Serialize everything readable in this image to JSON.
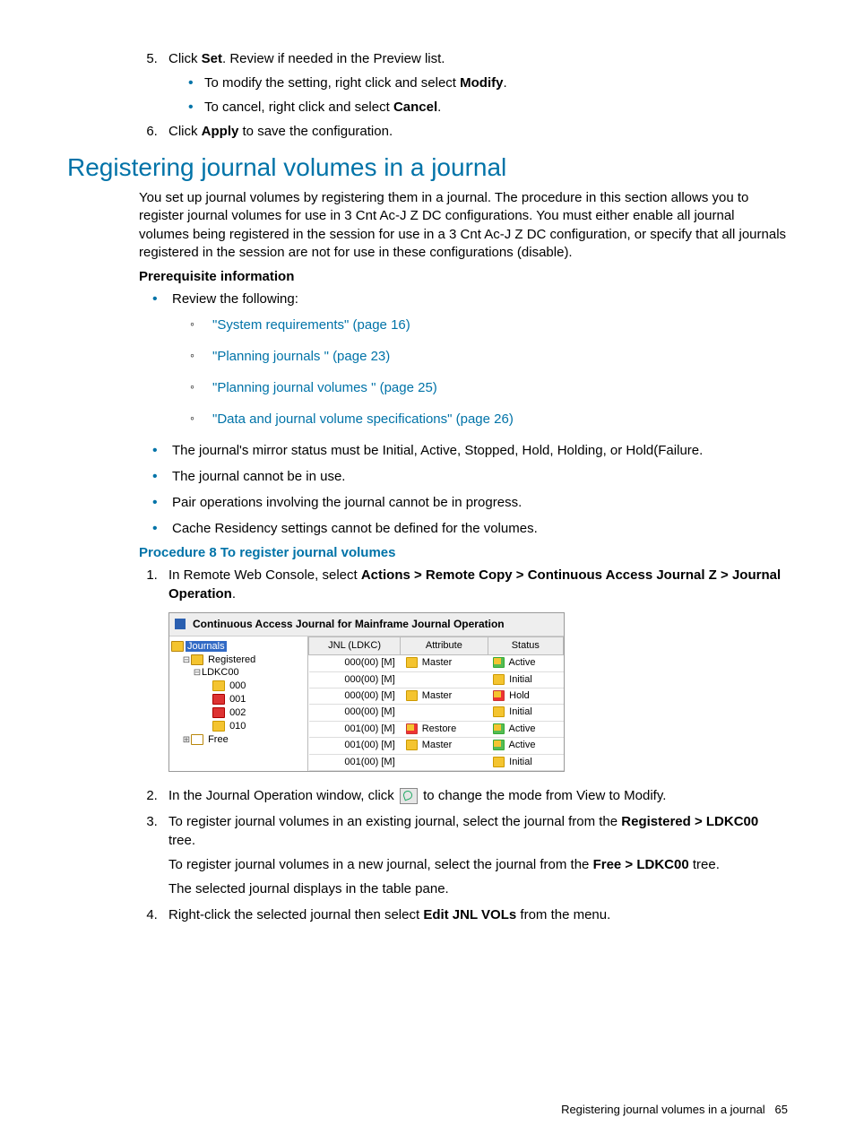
{
  "steps_a": {
    "s5_pre": "Click ",
    "s5_bold": "Set",
    "s5_post": ". Review if needed in the Preview list.",
    "s5_sub1_pre": "To modify the setting, right click and select ",
    "s5_sub1_bold": "Modify",
    "s5_sub1_post": ".",
    "s5_sub2_pre": "To cancel, right click and select ",
    "s5_sub2_bold": "Cancel",
    "s5_sub2_post": ".",
    "s6_pre": "Click ",
    "s6_bold": "Apply",
    "s6_post": " to save the configuration."
  },
  "heading": "Registering journal volumes in a journal",
  "intro": "You set up journal volumes by registering them in a journal. The procedure in this section allows you to register journal volumes for use in 3 Cnt Ac-J Z DC configurations. You must either enable all journal volumes being registered in the session for use in a 3 Cnt Ac-J Z DC configuration, or specify that all journals registered in the session are not for use in these configurations (disable).",
  "prereq_head": "Prerequisite information",
  "bullets": {
    "b1_lead": "Review the following:",
    "links": [
      "\"System requirements\" (page 16)",
      "\"Planning journals \" (page 23)",
      "\"Planning journal volumes \" (page 25)",
      "\"Data and journal volume specifications\" (page 26)"
    ],
    "b2": "The journal's mirror status must be Initial, Active, Stopped, Hold, Holding, or Hold(Failure.",
    "b3": "The journal cannot be in use.",
    "b4": "Pair operations involving the journal cannot be in progress.",
    "b5": "Cache Residency settings cannot be defined for the volumes."
  },
  "proc_head": "Procedure 8 To register journal volumes",
  "proc": {
    "s1_pre": "In Remote Web Console, select ",
    "s1_bold": "Actions > Remote Copy > Continuous Access Journal Z > Journal Operation",
    "s1_post": ".",
    "s2_pre": "In the Journal Operation window, click ",
    "s2_post": " to change the mode from View to Modify.",
    "s3_pre": "To register journal volumes in an existing journal, select the journal from the ",
    "s3_bold": "Registered > LDKC00",
    "s3_post": " tree.",
    "s3_p2_pre": "To register journal volumes in a new journal, select the journal from the ",
    "s3_p2_bold": "Free > LDKC00",
    "s3_p2_post": " tree.",
    "s3_p3": "The selected journal displays in the table pane.",
    "s4_pre": "Right-click the selected journal then select ",
    "s4_bold": "Edit JNL VOLs",
    "s4_post": " from the menu."
  },
  "app": {
    "title": "Continuous Access Journal for Mainframe Journal Operation",
    "tree": {
      "root": "Journals",
      "registered": "Registered",
      "ldkc": "LDKC00",
      "n000": "000",
      "n001": "001",
      "n002": "002",
      "n010": "010",
      "free": "Free"
    },
    "cols": {
      "c1": "JNL (LDKC)",
      "c2": "Attribute",
      "c3": "Status"
    },
    "rows": [
      {
        "jnl": "000(00) [M]",
        "attr": "Master",
        "status": "Active"
      },
      {
        "jnl": "000(00) [M]",
        "attr": "",
        "status": "Initial"
      },
      {
        "jnl": "000(00) [M]",
        "attr": "Master",
        "status": "Hold"
      },
      {
        "jnl": "000(00) [M]",
        "attr": "",
        "status": "Initial"
      },
      {
        "jnl": "001(00) [M]",
        "attr": "Restore",
        "status": "Active"
      },
      {
        "jnl": "001(00) [M]",
        "attr": "Master",
        "status": "Active"
      },
      {
        "jnl": "001(00) [M]",
        "attr": "",
        "status": "Initial"
      }
    ]
  },
  "footer": {
    "text": "Registering journal volumes in a journal",
    "page": "65"
  }
}
